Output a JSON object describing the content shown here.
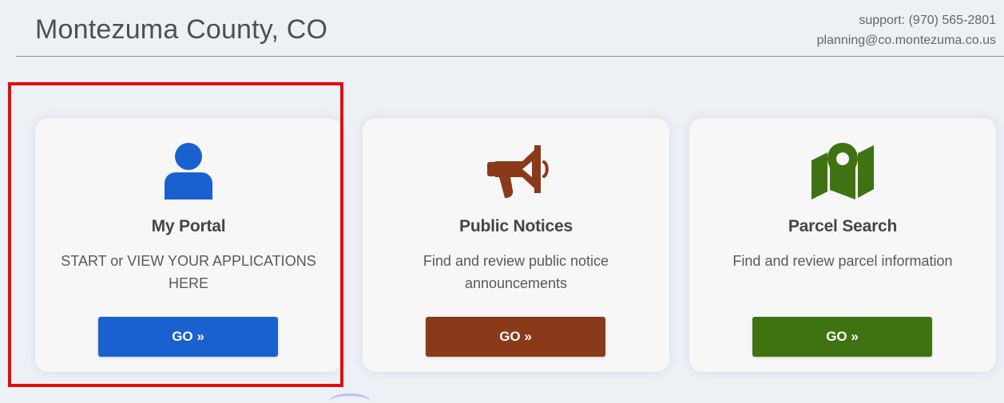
{
  "header": {
    "title": "Montezuma County, CO",
    "support": "support: (970) 565-2801",
    "email": "planning@co.montezuma.co.us"
  },
  "cards": [
    {
      "title": "My Portal",
      "description": "START or VIEW YOUR APPLICATIONS HERE",
      "button_label": "GO »",
      "icon": "user-icon",
      "accent": "#1a61d0"
    },
    {
      "title": "Public Notices",
      "description": "Find and review public notice announcements",
      "button_label": "GO »",
      "icon": "megaphone-icon",
      "accent": "#8b3a19"
    },
    {
      "title": "Parcel Search",
      "description": "Find and review parcel information",
      "button_label": "GO »",
      "icon": "map-pin-icon",
      "accent": "#3f7312"
    }
  ],
  "highlight": {
    "color": "#e50b0b"
  }
}
